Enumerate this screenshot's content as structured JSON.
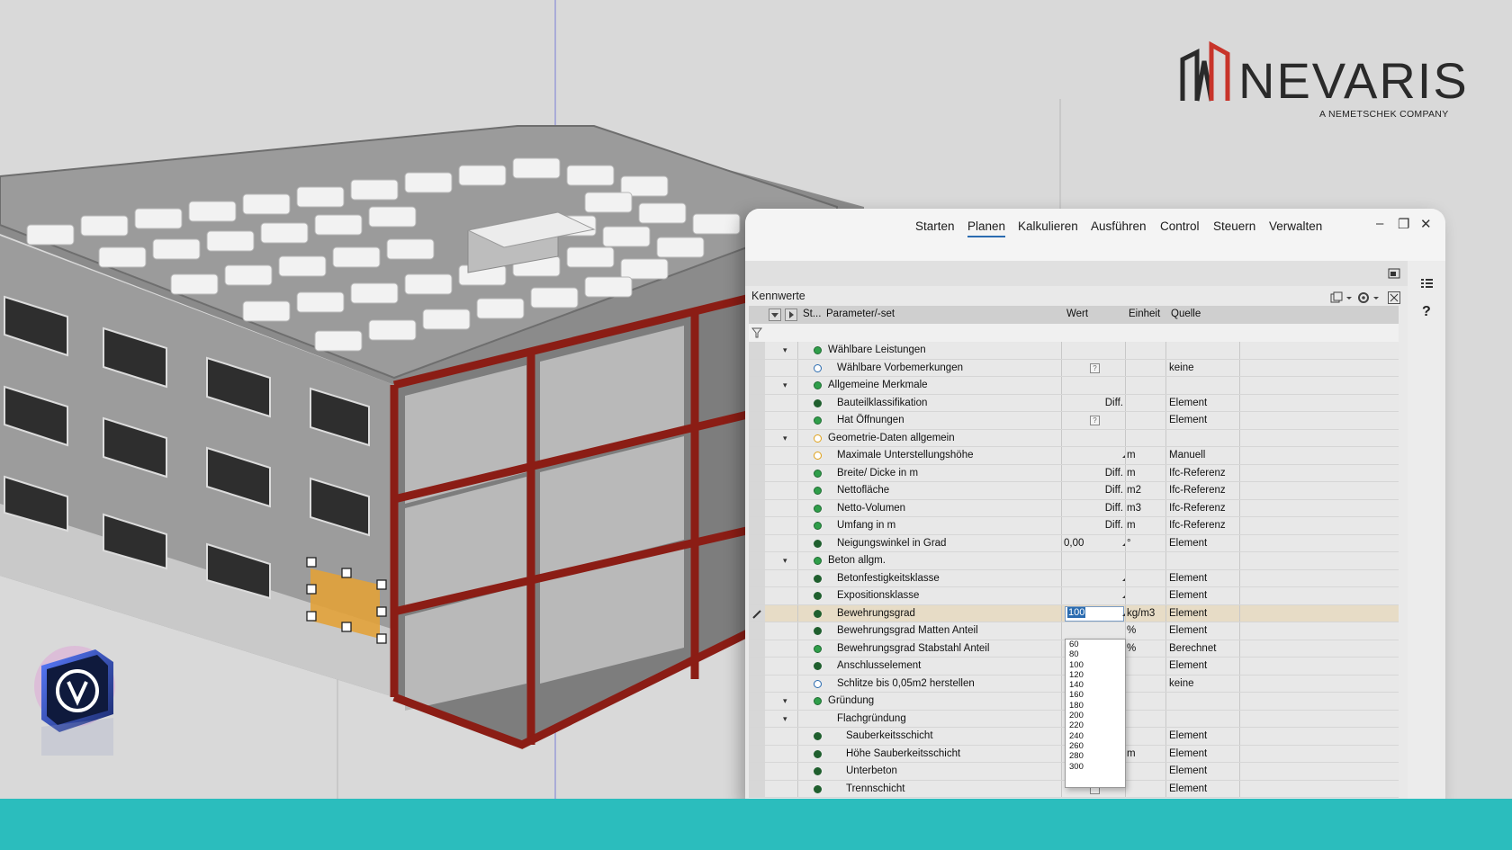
{
  "brand": {
    "logo_word": "NEVARIS",
    "logo_sub": "A NEMETSCHEK COMPANY",
    "red": "#c8342a",
    "accent_teal": "#2bbdbd"
  },
  "menu": {
    "items": [
      "Starten",
      "Planen",
      "Kalkulieren",
      "Ausführen",
      "Control",
      "Steuern",
      "Verwalten"
    ],
    "active": "Planen",
    "window_minimize": "–",
    "window_restore": "❐",
    "window_close": "✕"
  },
  "panel": {
    "title": "Kennwerte",
    "help_label": "?",
    "columns": {
      "status": "St...",
      "param": "Parameter/-set",
      "wert": "Wert",
      "einheit": "Einheit",
      "quelle": "Quelle"
    },
    "rows": [
      {
        "name": "Wählbare Leistungen",
        "indent": 0,
        "caret": "▾",
        "status": "ok",
        "wert": "",
        "unit": "",
        "src": ""
      },
      {
        "name": "Wählbare Vorbemerkungen",
        "indent": 1,
        "caret": "",
        "status": "info",
        "wert": "?",
        "unit": "",
        "src": "keine"
      },
      {
        "name": "Allgemeine Merkmale",
        "indent": 0,
        "caret": "▾",
        "status": "ok",
        "wert": "",
        "unit": "",
        "src": ""
      },
      {
        "name": "Bauteilklassifikation",
        "indent": 1,
        "caret": "",
        "status": "dot",
        "wert": "Diff.",
        "unit": "",
        "src": "Element"
      },
      {
        "name": "Hat Öffnungen",
        "indent": 1,
        "caret": "",
        "status": "ok",
        "wert": "?",
        "unit": "",
        "src": "Element"
      },
      {
        "name": "Geometrie-Daten allgemein",
        "indent": 0,
        "caret": "▾",
        "status": "warn",
        "wert": "",
        "unit": "",
        "src": ""
      },
      {
        "name": "Maximale Unterstellungshöhe",
        "indent": 1,
        "caret": "",
        "status": "warn",
        "wert": "",
        "dropdown": true,
        "unit": "m",
        "src": "Manuell"
      },
      {
        "name": "Breite/ Dicke in m",
        "indent": 1,
        "caret": "",
        "status": "ok",
        "wert": "Diff.",
        "unit": "m",
        "src": "Ifc-Referenz"
      },
      {
        "name": "Nettofläche",
        "indent": 1,
        "caret": "",
        "status": "ok",
        "wert": "Diff.",
        "unit": "m2",
        "src": "Ifc-Referenz"
      },
      {
        "name": "Netto-Volumen",
        "indent": 1,
        "caret": "",
        "status": "ok",
        "wert": "Diff.",
        "unit": "m3",
        "src": "Ifc-Referenz"
      },
      {
        "name": "Umfang in m",
        "indent": 1,
        "caret": "",
        "status": "ok",
        "wert": "Diff.",
        "unit": "m",
        "src": "Ifc-Referenz"
      },
      {
        "name": "Neigungswinkel in Grad",
        "indent": 1,
        "caret": "",
        "status": "dot",
        "wert": "0,00",
        "dropdown": true,
        "unit": "°",
        "src": "Element"
      },
      {
        "name": "Beton allgm.",
        "indent": 0,
        "caret": "▾",
        "status": "ok",
        "wert": "",
        "unit": "",
        "src": ""
      },
      {
        "name": "Betonfestigkeitsklasse",
        "indent": 1,
        "caret": "",
        "status": "dot",
        "wert": "",
        "dropdown": true,
        "unit": "",
        "src": "Element"
      },
      {
        "name": "Expositionsklasse",
        "indent": 1,
        "caret": "",
        "status": "dot",
        "wert": "",
        "dropdown": true,
        "unit": "",
        "src": "Element"
      },
      {
        "name": "Bewehrungsgrad",
        "indent": 1,
        "caret": "",
        "status": "dot",
        "wert": "100",
        "editing": true,
        "unit": "kg/m3",
        "src": "Element"
      },
      {
        "name": "Bewehrungsgrad Matten Anteil",
        "indent": 1,
        "caret": "",
        "status": "dot",
        "wert": "",
        "unit": "%",
        "src": "Element"
      },
      {
        "name": "Bewehrungsgrad Stabstahl Anteil",
        "indent": 1,
        "caret": "",
        "status": "ok",
        "wert": "",
        "unit": "%",
        "src": "Berechnet"
      },
      {
        "name": "Anschlusselement",
        "indent": 1,
        "caret": "",
        "status": "dot",
        "wert": "",
        "unit": "",
        "src": "Element"
      },
      {
        "name": "Schlitze bis 0,05m2 herstellen",
        "indent": 1,
        "caret": "",
        "status": "info",
        "wert": "",
        "unit": "",
        "src": "keine"
      },
      {
        "name": "Gründung",
        "indent": 0,
        "caret": "▾",
        "status": "ok",
        "wert": "",
        "unit": "",
        "src": ""
      },
      {
        "name": "Flachgründung",
        "indent": 1,
        "caret": "▾",
        "status": "",
        "wert": "",
        "unit": "",
        "src": ""
      },
      {
        "name": "Sauberkeitsschicht",
        "indent": 2,
        "caret": "",
        "status": "dot",
        "wert": "",
        "unit": "",
        "src": "Element"
      },
      {
        "name": "Höhe Sauberkeitsschicht",
        "indent": 2,
        "caret": "",
        "status": "dot",
        "wert": "",
        "unit": "m",
        "src": "Element"
      },
      {
        "name": "Unterbeton",
        "indent": 2,
        "caret": "",
        "status": "dot",
        "wert": "",
        "unit": "",
        "src": "Element"
      },
      {
        "name": "Trennschicht",
        "indent": 2,
        "caret": "",
        "status": "dot",
        "wert": "",
        "checkbox": true,
        "unit": "",
        "src": "Element"
      }
    ],
    "dropdown_options": [
      "60",
      "80",
      "100",
      "120",
      "140",
      "160",
      "180",
      "200",
      "220",
      "240",
      "260",
      "280",
      "300"
    ]
  }
}
